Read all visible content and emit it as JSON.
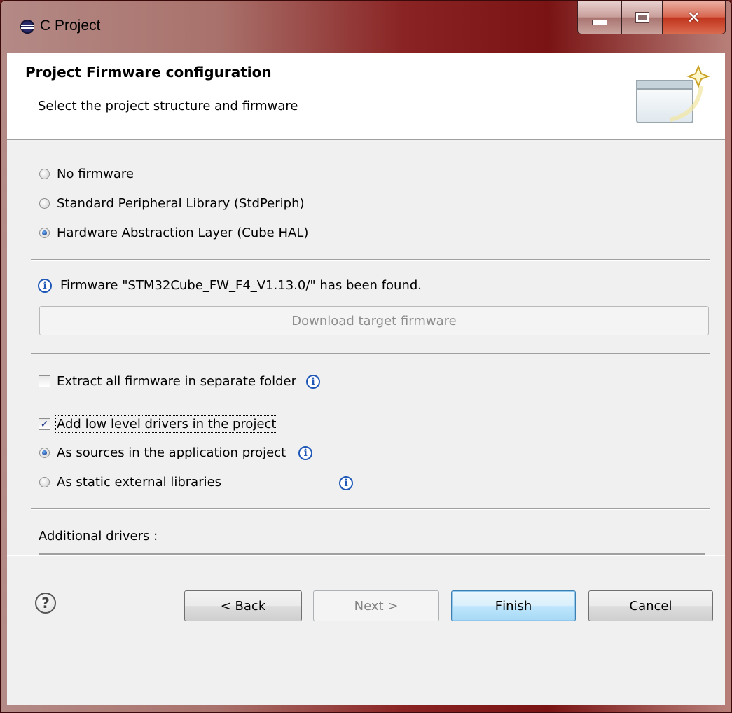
{
  "window": {
    "title": "C Project",
    "icon": "eclipse-icon"
  },
  "header": {
    "title": "Project Firmware configuration",
    "subtitle": "Select the project structure and firmware",
    "icon": "wizard-banner-icon"
  },
  "firmware_options": {
    "no_firmware": "No firmware",
    "std_periph": "Standard Peripheral Library (StdPeriph)",
    "cube_hal": "Hardware Abstraction Layer (Cube HAL)",
    "selected": "cube_hal"
  },
  "firmware_status": {
    "message": "Firmware \"STM32Cube_FW_F4_V1.13.0/\" has been found.",
    "download_button": "Download target firmware"
  },
  "options": {
    "extract_label": "Extract all firmware in separate folder",
    "extract_checked": false,
    "add_drivers_label": "Add low level drivers in the project",
    "add_drivers_checked": true,
    "as_sources_label": "As sources in the application project",
    "as_static_label": "As static external libraries",
    "driver_mode_selected": "as_sources"
  },
  "additional_drivers_label": "Additional drivers :",
  "footer": {
    "back_prefix": "< ",
    "back_mnemonic": "B",
    "back_rest": "ack",
    "next_mnemonic": "N",
    "next_rest": "ext >",
    "finish_mnemonic": "F",
    "finish_rest": "inish",
    "cancel": "Cancel"
  },
  "colors": {
    "accent": "#1f58b7",
    "default_button": "#3c7fb1",
    "titlebar": "#8a2424"
  }
}
